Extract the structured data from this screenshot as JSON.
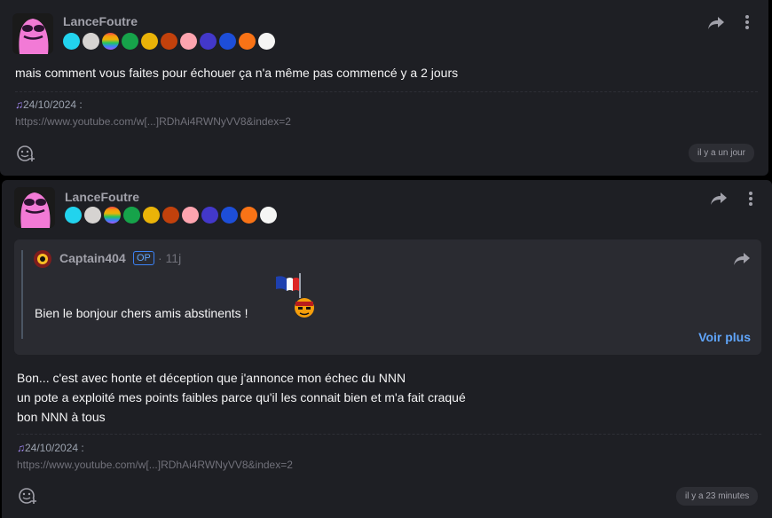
{
  "posts": [
    {
      "username": "LanceFoutre",
      "text_lines": [
        "mais comment vous faites pour échouer ça n'a même pas commencé y a 2 jours"
      ],
      "signature_date": "24/10/2024 :",
      "signature_link": "https://www.youtube.com/w[...]RDhAi4RWNyVV8&index=2",
      "time": "il y a un jour",
      "badges": [
        "ice-crystal",
        "old-man",
        "rainbow",
        "green-hat",
        "gold-face",
        "bearded-face",
        "blonde-face",
        "moon-planet",
        "blue-hair-face",
        "palette",
        "spiral-face"
      ]
    },
    {
      "username": "LanceFoutre",
      "quote": {
        "author": "Captain404",
        "op_label": "OP",
        "age": "· 11j",
        "text": "Bien le bonjour chers amis abstinents !",
        "see_more": "Voir plus"
      },
      "text_lines": [
        "Bon... c'est avec honte et déception que j'annonce mon échec du NNN",
        "un pote a exploité mes points faibles parce qu'il les connait bien et m'a fait craqué",
        "bon NNN à tous"
      ],
      "signature_date": "24/10/2024 :",
      "signature_link": "https://www.youtube.com/w[...]RDhAi4RWNyVV8&index=2",
      "time": "il y a 23 minutes",
      "badges": [
        "ice-crystal",
        "old-man",
        "rainbow",
        "green-hat",
        "gold-face",
        "bearded-face",
        "blonde-face",
        "moon-planet",
        "blue-hair-face",
        "palette",
        "spiral-face"
      ]
    }
  ],
  "colors": {
    "card_bg": "#1e1f24",
    "quote_bg": "#2a2b31",
    "accent_blue": "#60a5fa",
    "avatar_pink": "#f472d0"
  }
}
